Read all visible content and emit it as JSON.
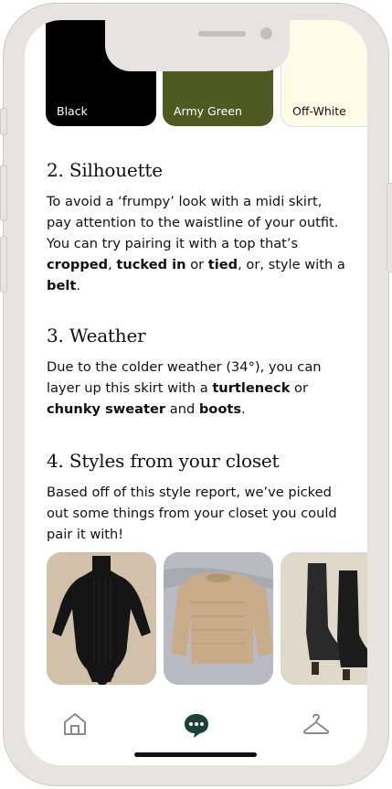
{
  "colors": {
    "accent": "#1f4036",
    "frame": "#e7e3e1",
    "swatch_black": "#000000",
    "swatch_army_green": "#4f5a23",
    "swatch_off_white": "#fffbe6"
  },
  "swatches": [
    {
      "label": "Black"
    },
    {
      "label": "Army Green"
    },
    {
      "label": "Off-White"
    }
  ],
  "sections": {
    "silhouette": {
      "title": "2. Silhouette",
      "t1": "To avoid a ‘frumpy’ look with a midi skirt, pay attention to the waistline of your outfit. You can try pairing it with a top that’s ",
      "b1": "cropped",
      "t2": ", ",
      "b2": "tucked in",
      "t3": " or ",
      "b3": "tied",
      "t4": ", or, style with a ",
      "b4": "belt",
      "t5": "."
    },
    "weather": {
      "title": "3. Weather",
      "t1": "Due to the colder weather (34°), you can layer up this skirt with a ",
      "b1": "turtleneck",
      "t2": " or ",
      "b2": "chunky sweater",
      "t3": " and ",
      "b3": "boots",
      "t4": "."
    },
    "closet": {
      "title": "4. Styles from your closet",
      "text": "Based off of this style report, we’ve picked out some things from your closet you could pair it with!",
      "items": [
        {
          "icon": "black-turtleneck-bodysuit-photo"
        },
        {
          "icon": "beige-chunky-sweater-photo"
        },
        {
          "icon": "black-knee-high-boots-photo"
        }
      ]
    }
  },
  "nav": {
    "items": [
      {
        "icon": "home-icon",
        "active": false
      },
      {
        "icon": "chat-bubble-icon",
        "active": true
      },
      {
        "icon": "hanger-icon",
        "active": false
      }
    ]
  }
}
